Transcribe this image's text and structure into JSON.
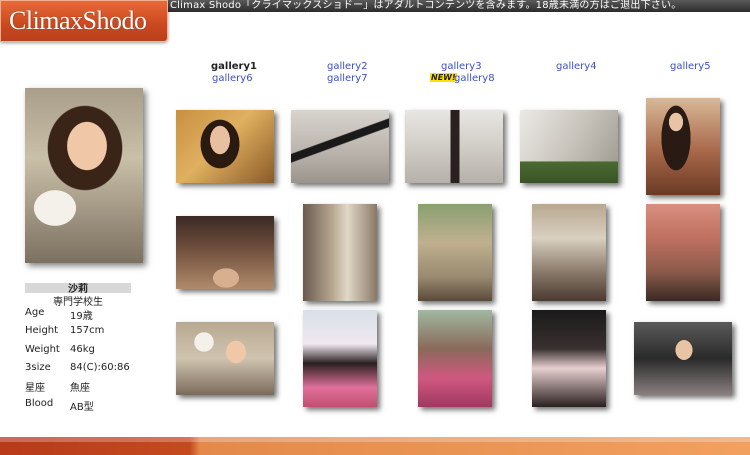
{
  "header": {
    "logo_text": "ClimaxShodo",
    "notice": "Climax Shodo「クライマックスショドー」はアダルトコンテンツを含みます。18歳未満の方はご退出下さい。"
  },
  "profile": {
    "name": "沙莉",
    "occupation": "専門学校生",
    "rows": [
      {
        "label": "Age",
        "value": "19歳"
      },
      {
        "label": "Height",
        "value": "157cm"
      },
      {
        "label": "Weight",
        "value": "46kg"
      },
      {
        "label": "3size",
        "value": "84(C):60:86"
      },
      {
        "label": "星座",
        "value": "魚座"
      },
      {
        "label": "Blood",
        "value": "AB型"
      }
    ]
  },
  "galleries": [
    {
      "label": "gallery1"
    },
    {
      "label": "gallery2"
    },
    {
      "label": "gallery3"
    },
    {
      "label": "gallery4"
    },
    {
      "label": "gallery5"
    },
    {
      "label": "gallery6"
    },
    {
      "label": "gallery7"
    },
    {
      "label": "gallery8"
    }
  ],
  "new_badge": "NEW!",
  "colors": {
    "logo_orange": "#cc4a20",
    "link_blue": "#3a50c8",
    "footer_dark": "#b83a1a",
    "footer_light": "#f2a060"
  }
}
